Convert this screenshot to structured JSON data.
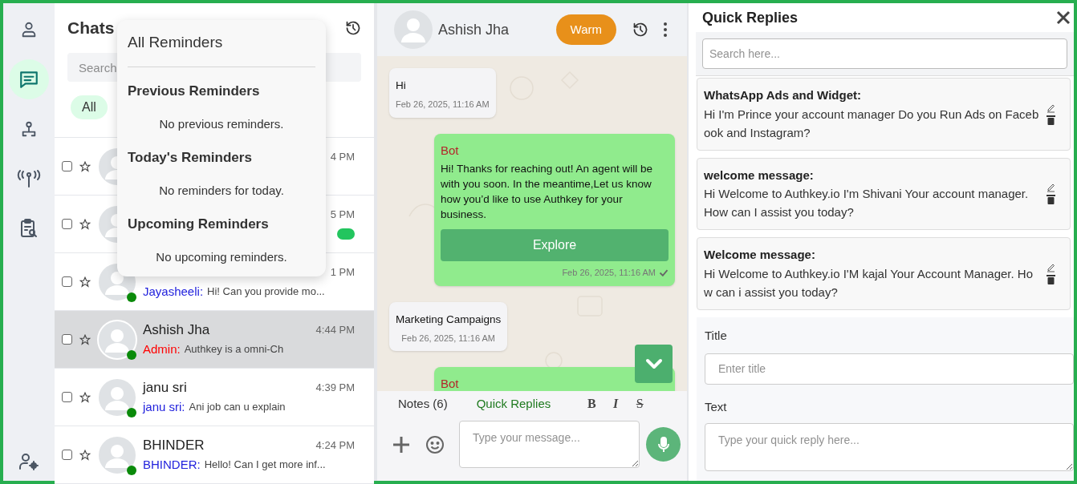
{
  "nav": {
    "items": [
      {
        "kind": "profile",
        "selected": false
      },
      {
        "kind": "chats",
        "selected": true
      },
      {
        "kind": "team",
        "selected": false
      },
      {
        "kind": "broadcast",
        "selected": false
      },
      {
        "kind": "reports",
        "selected": false
      }
    ],
    "footer": {
      "kind": "user-settings"
    }
  },
  "chat_list": {
    "title": "Chats",
    "search": {
      "placeholder": "Search"
    },
    "filters": [
      {
        "label": "All",
        "selected": true
      }
    ],
    "rows": [
      {
        "time": "4 PM",
        "selected": false
      },
      {
        "time": "5 PM",
        "selected": false,
        "unread": true
      },
      {
        "time": "1 PM",
        "selected": false,
        "online": true,
        "unread": false,
        "sender": {
          "text": "Jayasheeli:",
          "color": "#2222dd"
        },
        "preview": "Hi! Can you provide mo..."
      },
      {
        "name": "Ashish Jha",
        "time": "4:44 PM",
        "selected": true,
        "online": true,
        "unread": false,
        "sender": {
          "text": "Admin:",
          "color": "#ff0000"
        },
        "preview": "Authkey is a omni-Ch"
      },
      {
        "name": "janu sri",
        "time": "4:39 PM",
        "selected": false,
        "online": true,
        "unread": false,
        "sender": {
          "text": "janu sri:",
          "color": "#2222dd"
        },
        "preview": "Ani job can u explain"
      },
      {
        "name": "BHINDER",
        "time": "4:24 PM",
        "selected": false,
        "online": true,
        "unread": false,
        "sender": {
          "text": "BHINDER:",
          "color": "#2222dd"
        },
        "preview": "Hello! Can I get more inf..."
      }
    ]
  },
  "reminders": {
    "title": "All Reminders",
    "sections": [
      {
        "heading": "Previous Reminders",
        "empty": "No previous reminders."
      },
      {
        "heading": "Today's Reminders",
        "empty": "No reminders for today."
      },
      {
        "heading": "Upcoming Reminders",
        "empty": "No upcoming reminders."
      }
    ]
  },
  "chat": {
    "name": "Ashish Jha",
    "status": "Warm",
    "messages": [
      {
        "kind": "incoming",
        "text": "Hi",
        "time": "Feb 26, 2025, 11:16 AM"
      },
      {
        "kind": "outgoing",
        "sender": "Bot",
        "text": "Hi! Thanks for reaching out! An agent will be with you soon. In the meantime,Let us know how you’d like to use Authkey for your business.",
        "buttons": [
          "Explore"
        ],
        "time": "Feb 26, 2025, 11:16 AM",
        "delivered": true
      },
      {
        "kind": "incoming",
        "text": "Marketing Campaigns",
        "time": "Feb 26, 2025, 11:16 AM"
      },
      {
        "kind": "outgoing",
        "sender": "Bot"
      }
    ],
    "composer": {
      "tabs": [
        {
          "label": "Notes (6)",
          "selected": false
        },
        {
          "label": "Quick Replies",
          "selected": true
        }
      ],
      "format": [
        {
          "kind": "bold",
          "label": "B"
        },
        {
          "kind": "italic",
          "label": "I"
        },
        {
          "kind": "strike",
          "label": "S"
        }
      ],
      "placeholder": "Type your message..."
    }
  },
  "quick_replies": {
    "title": "Quick Replies",
    "search": {
      "placeholder": "Search here..."
    },
    "items": [
      {
        "title": "WhatsApp Ads and Widget:",
        "text": "Hi I'm Prince your account manager Do you Run Ads on Facebook and Instagram?"
      },
      {
        "title": "welcome message:",
        "text": "Hi Welcome to Authkey.io I'm Shivani Your account manager. How can I assist you today?"
      },
      {
        "title": "Welcome message:",
        "text": "Hi Welcome to Authkey.io I'M kajal Your Account Manager. How can i assist you today?"
      }
    ],
    "form": {
      "title_label": "Title",
      "title_placeholder": "Enter title",
      "text_label": "Text",
      "text_placeholder": "Type your quick reply here..."
    }
  }
}
